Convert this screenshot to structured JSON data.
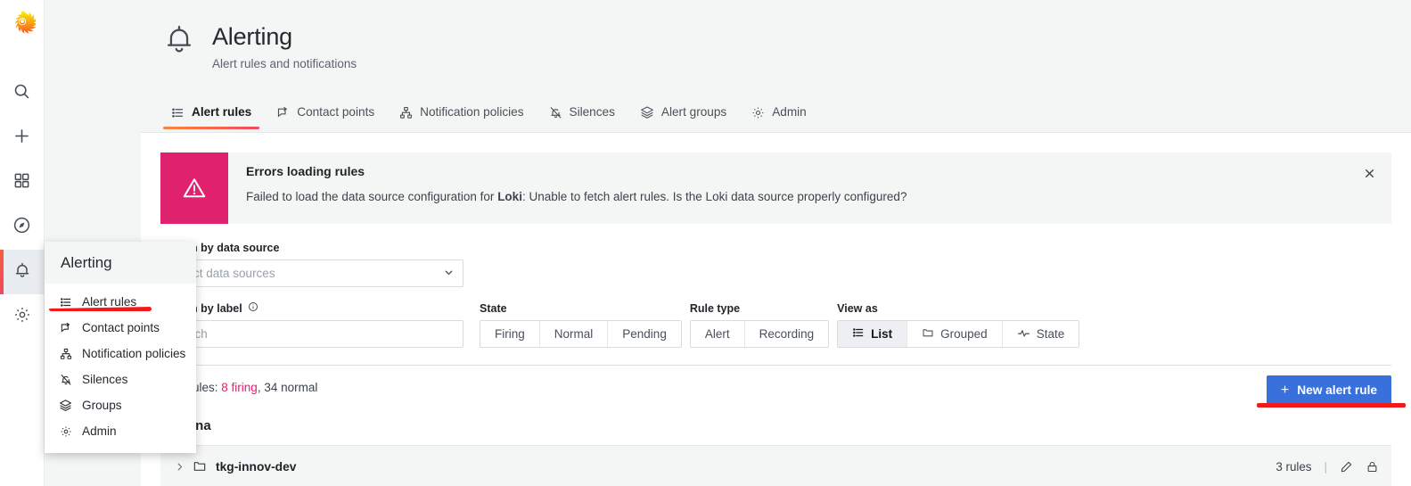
{
  "sidebar": {
    "logo": "grafana-logo",
    "items": [
      {
        "icon": "search-icon",
        "name": "search"
      },
      {
        "icon": "plus-icon",
        "name": "create"
      },
      {
        "icon": "dashboards-icon",
        "name": "dashboards"
      },
      {
        "icon": "compass-icon",
        "name": "explore"
      },
      {
        "icon": "bell-icon",
        "name": "alerting",
        "active": true
      },
      {
        "icon": "gear-icon",
        "name": "configuration"
      }
    ]
  },
  "header": {
    "icon": "bell-icon",
    "title": "Alerting",
    "subtitle": "Alert rules and notifications"
  },
  "tabs": [
    {
      "label": "Alert rules",
      "icon": "list-icon",
      "active": true
    },
    {
      "label": "Contact points",
      "icon": "comment-share-icon",
      "active": false
    },
    {
      "label": "Notification policies",
      "icon": "sitemap-icon",
      "active": false
    },
    {
      "label": "Silences",
      "icon": "bell-slash-icon",
      "active": false
    },
    {
      "label": "Alert groups",
      "icon": "layer-group-icon",
      "active": false
    },
    {
      "label": "Admin",
      "icon": "gear-icon",
      "active": false
    }
  ],
  "alert": {
    "icon": "warning-triangle-icon",
    "title": "Errors loading rules",
    "message_prefix": "Failed to load the data source configuration for ",
    "message_source": "Loki",
    "message_suffix": ": Unable to fetch alert rules. Is the Loki data source properly configured?",
    "close_icon": "close-icon",
    "accent_color": "#E0226E"
  },
  "filters": {
    "datasource": {
      "label": "Search by data source",
      "placeholder": "Select data sources",
      "value": "",
      "chevron": "chevron-down-icon"
    },
    "label_filter": {
      "label": "Search by label",
      "info_icon": "info-circle-icon",
      "placeholder": "Search",
      "value": ""
    },
    "state": {
      "label": "State",
      "options": [
        "Firing",
        "Normal",
        "Pending"
      ],
      "selected": ""
    },
    "rule_type": {
      "label": "Rule type",
      "options": [
        "Alert",
        "Recording"
      ],
      "selected": ""
    },
    "view_as": {
      "label": "View as",
      "options": [
        {
          "label": "List",
          "icon": "list-icon"
        },
        {
          "label": "Grouped",
          "icon": "folder-icon"
        },
        {
          "label": "State",
          "icon": "heart-rate-icon"
        }
      ],
      "selected": "List"
    }
  },
  "summary": {
    "prefix": "Alert rules: ",
    "firing": "8 firing",
    "rest": ", 34 normal"
  },
  "new_rule_button": {
    "label": "New alert rule",
    "icon": "plus-icon",
    "color": "#3871DC"
  },
  "datasource_heading": "Grafana",
  "rules": [
    {
      "expand_icon": "chevron-right-icon",
      "folder_icon": "folder-icon",
      "name": "tkg-innov-dev",
      "count": "3 rules",
      "separator": "|",
      "edit_icon": "pencil-icon",
      "lock_icon": "lock-icon"
    }
  ],
  "flyout": {
    "title": "Alerting",
    "items": [
      {
        "label": "Alert rules",
        "icon": "list-icon",
        "highlighted": true
      },
      {
        "label": "Contact points",
        "icon": "comment-share-icon"
      },
      {
        "label": "Notification policies",
        "icon": "sitemap-icon"
      },
      {
        "label": "Silences",
        "icon": "bell-slash-icon"
      },
      {
        "label": "Groups",
        "icon": "layer-group-icon"
      },
      {
        "label": "Admin",
        "icon": "gear-icon"
      }
    ]
  },
  "annotations": {
    "color": "#F01A1A",
    "marks": [
      "underline-alert-rules-menu-item",
      "underline-new-alert-rule-button"
    ]
  }
}
